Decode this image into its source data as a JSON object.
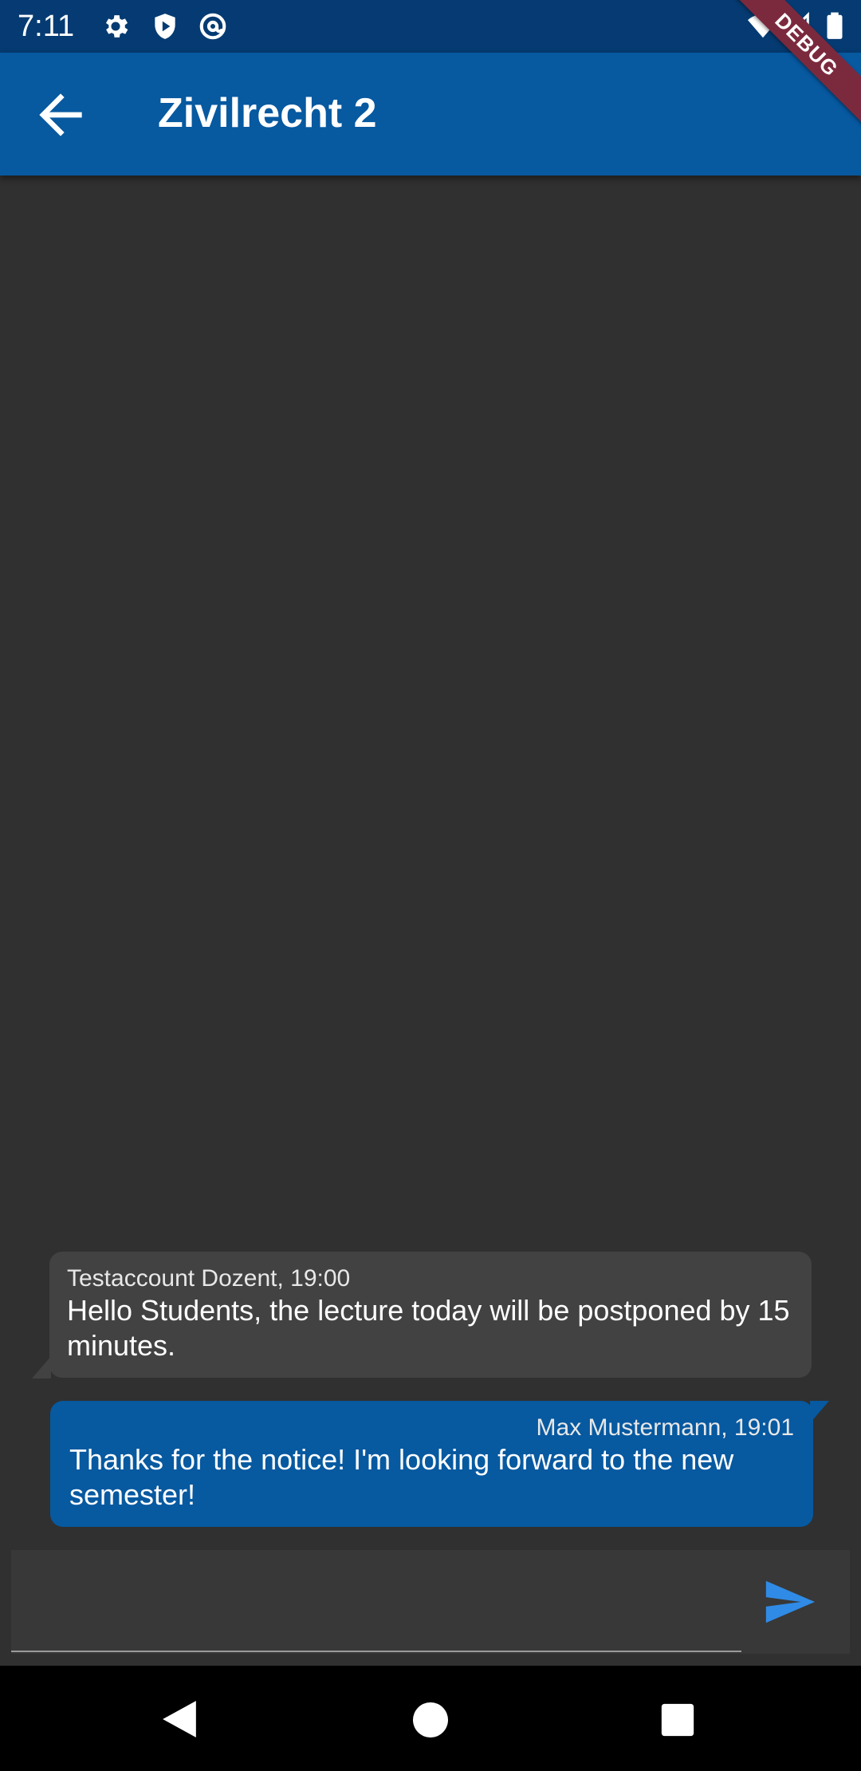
{
  "status_bar": {
    "time": "7:11",
    "icons": [
      "gear-icon",
      "shield-play-icon",
      "at-sign-icon",
      "wifi-icon",
      "cell-signal-icon",
      "battery-icon"
    ]
  },
  "debug_banner": "DEBUG",
  "app_bar": {
    "title": "Zivilrecht 2",
    "back_icon": "arrow-back-icon"
  },
  "messages": [
    {
      "sender": "Testaccount Dozent, 19:00",
      "text": "Hello Students, the lecture today will be postponed by 15 minutes.",
      "direction": "incoming",
      "bubble_color": "#424242"
    },
    {
      "sender": "Max Mustermann, 19:01",
      "text": "Thanks for the notice! I'm looking forward to the new semester!",
      "direction": "outgoing",
      "bubble_color": "#0759a0"
    }
  ],
  "composer": {
    "value": "",
    "placeholder": "",
    "send_icon": "send-icon",
    "send_color": "#2f8be6"
  },
  "nav_bar": {
    "icons": [
      "back-triangle-icon",
      "home-circle-icon",
      "recents-square-icon"
    ]
  },
  "colors": {
    "status_bar": "#053b72",
    "app_bar": "#0759a0",
    "background": "#303030",
    "debug_banner": "#7b2a3e"
  }
}
